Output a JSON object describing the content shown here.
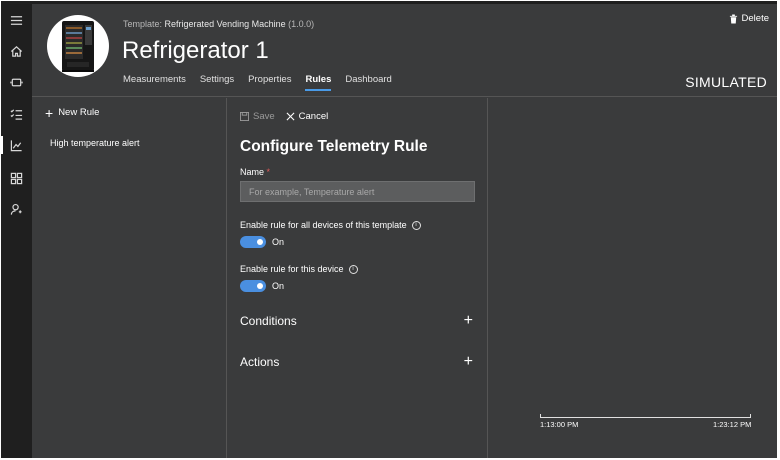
{
  "rail": {
    "items": [
      {
        "icon": "hamburger-menu-icon"
      },
      {
        "icon": "home-icon"
      },
      {
        "icon": "devices-icon"
      },
      {
        "icon": "rules-list-icon"
      },
      {
        "icon": "analytics-icon",
        "active": true
      },
      {
        "icon": "dashboard-icon"
      },
      {
        "icon": "user-admin-icon"
      }
    ]
  },
  "header": {
    "template_prefix": "Template:",
    "template_name": "Refrigerated Vending Machine",
    "template_version": "(1.0.0)",
    "device_name": "Refrigerator 1",
    "tabs": [
      {
        "label": "Measurements"
      },
      {
        "label": "Settings"
      },
      {
        "label": "Properties"
      },
      {
        "label": "Rules",
        "active": true
      },
      {
        "label": "Dashboard"
      }
    ],
    "delete_label": "Delete",
    "status": "SIMULATED"
  },
  "rules": {
    "new_rule_label": "New Rule",
    "items": [
      "High temperature alert"
    ]
  },
  "config": {
    "save_label": "Save",
    "cancel_label": "Cancel",
    "title": "Configure Telemetry Rule",
    "name_label": "Name",
    "name_required_mark": "*",
    "name_value": "",
    "name_placeholder": "For example, Temperature alert",
    "toggle_template_label": "Enable rule for all devices of this template",
    "toggle_template_state": "On",
    "toggle_device_label": "Enable rule for this device",
    "toggle_device_state": "On",
    "conditions_label": "Conditions",
    "actions_label": "Actions"
  },
  "chart": {
    "start_time": "1:13:00 PM",
    "end_time": "1:23:12 PM"
  },
  "colors": {
    "accent": "#4a8fe0",
    "background": "#3a3b3c",
    "rail": "#1f1f1f",
    "required": "#e05a5a"
  }
}
